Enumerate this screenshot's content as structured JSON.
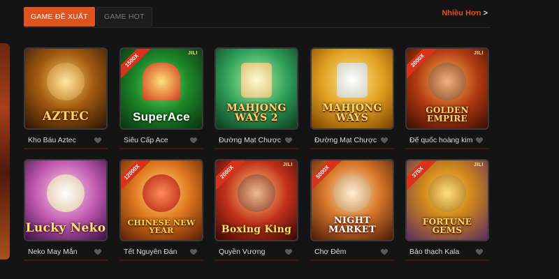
{
  "tabs": [
    {
      "label": "GAME ĐỀ XUẤT",
      "active": true
    },
    {
      "label": "GAME HOT",
      "active": false
    }
  ],
  "more_link": {
    "label": "Nhiều Hơn",
    "chevron": ">"
  },
  "accent_color": "#e0521e",
  "games": [
    {
      "art": "AZTEC",
      "caption": "Kho Báu Aztec",
      "ribbon": ""
    },
    {
      "art": "SuperAce",
      "caption": "Siêu Cấp Ace",
      "ribbon": "1500X"
    },
    {
      "art": "MAHJONG WAYS 2",
      "caption": "Đường Mạt Chược",
      "ribbon": ""
    },
    {
      "art": "MAHJONG WAYS",
      "caption": "Đường Mạt Chược",
      "ribbon": ""
    },
    {
      "art": "GOLDEN EMPIRE",
      "caption": "Đế quốc hoàng kim",
      "ribbon": "2000X"
    },
    {
      "art": "Lucky Neko",
      "caption": "Neko May Mắn",
      "ribbon": ""
    },
    {
      "art": "CHINESE NEW YEAR",
      "caption": "Tết Nguyên Đán",
      "ribbon": "12000X"
    },
    {
      "art": "Boxing King",
      "caption": "Quyền Vương",
      "ribbon": "2000X"
    },
    {
      "art": "NIGHT MARKET",
      "caption": "Chợ Đêm",
      "ribbon": "5000X"
    },
    {
      "art": "FORTUNE GEMS",
      "caption": "Bảo thạch Kala",
      "ribbon": "375X"
    }
  ]
}
